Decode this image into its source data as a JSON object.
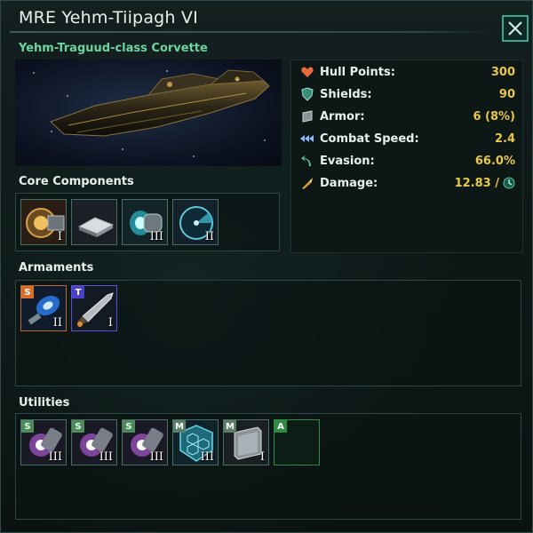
{
  "window": {
    "title": "MRE Yehm-Tiipagh VI",
    "ship_class": "Yehm-Traguud-class Corvette"
  },
  "stats": [
    {
      "label": "Hull Points:",
      "value": "300",
      "icon": "heart-icon"
    },
    {
      "label": "Shields:",
      "value": "90",
      "icon": "shield-icon"
    },
    {
      "label": "Armor:",
      "value": "6 (8%)",
      "icon": "armor-icon"
    },
    {
      "label": "Combat Speed:",
      "value": "2.4",
      "icon": "speed-icon"
    },
    {
      "label": "Evasion:",
      "value": "66.0%",
      "icon": "evasion-icon"
    },
    {
      "label": "Damage:",
      "value": "12.83 /",
      "icon": "damage-icon"
    }
  ],
  "sections": {
    "core": "Core Components",
    "armaments": "Armaments",
    "utilities": "Utilities"
  },
  "core_components": [
    {
      "icon": "reactor-icon",
      "tier": "I"
    },
    {
      "icon": "computer-chip-icon",
      "tier": ""
    },
    {
      "icon": "thruster-icon",
      "tier": "III"
    },
    {
      "icon": "sensor-icon",
      "tier": "II"
    }
  ],
  "armaments": [
    {
      "size": "S",
      "icon": "plasma-weapon-icon",
      "tier": "II"
    },
    {
      "size": "T",
      "icon": "torpedo-icon",
      "tier": "I"
    }
  ],
  "utilities": [
    {
      "size": "S",
      "icon": "shield-generator-icon",
      "tier": "III"
    },
    {
      "size": "S",
      "icon": "shield-generator-icon",
      "tier": "III"
    },
    {
      "size": "S",
      "icon": "shield-generator-icon",
      "tier": "III"
    },
    {
      "size": "M",
      "icon": "hex-shield-icon",
      "tier": "III"
    },
    {
      "size": "M",
      "icon": "armor-plate-icon",
      "tier": "I"
    },
    {
      "size": "A",
      "icon": "empty-slot-icon",
      "tier": ""
    }
  ]
}
